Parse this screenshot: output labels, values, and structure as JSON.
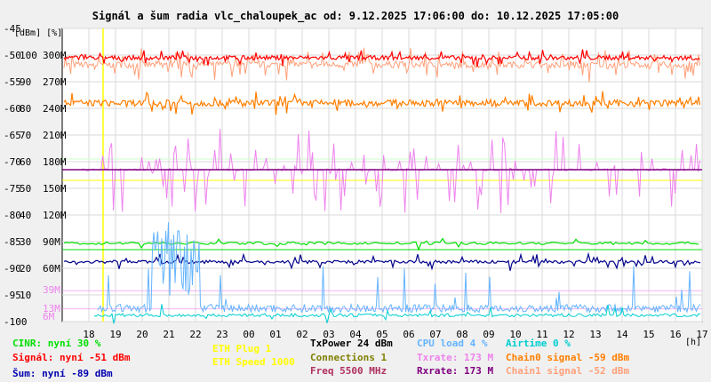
{
  "chart_data": {
    "type": "line",
    "title": "Signál a šum radia vlc_chaloupek_ac od: 9.12.2025 17:06:00 do: 10.12.2025 17:05:00",
    "ylabel": "[dBm] [%]",
    "xlabel": "[h]",
    "x_ticks": [
      "18",
      "19",
      "20",
      "21",
      "22",
      "23",
      "00",
      "01",
      "02",
      "03",
      "04",
      "05",
      "06",
      "07",
      "08",
      "09",
      "10",
      "11",
      "12",
      "13",
      "14",
      "15",
      "16",
      "17"
    ],
    "y_ticks_dbm": [
      "-45",
      "-50",
      "-55",
      "-60",
      "-65",
      "-70",
      "-75",
      "-80",
      "-85",
      "-90",
      "-95",
      "-100"
    ],
    "y_ticks_pct": [
      "100",
      "90",
      "80",
      "70",
      "60",
      "50",
      "40",
      "30",
      "20",
      "10"
    ],
    "y_ticks_rate": [
      "300M",
      "270M",
      "240M",
      "210M",
      "180M",
      "150M",
      "120M",
      "90M",
      "60M",
      "39M",
      "13M",
      "6M"
    ],
    "ylim_dbm": [
      -100,
      -45
    ],
    "grid": true,
    "series": [
      {
        "name": "Signál",
        "color": "#ff0000",
        "level_dbm": -51
      },
      {
        "name": "Chain0 signal",
        "color": "#ff7f00",
        "level_dbm": -59
      },
      {
        "name": "Chain1 signal",
        "color": "#ffa07a",
        "level_dbm": -52
      },
      {
        "name": "Txrate",
        "color": "#ee82ee",
        "level_rate": "173 M"
      },
      {
        "name": "Rxrate",
        "color": "#800080",
        "level_rate": "173 M"
      },
      {
        "name": "CINR",
        "color": "#00ff00",
        "level_pct": 30
      },
      {
        "name": "Šum",
        "color": "#00008b",
        "level_dbm": -89
      },
      {
        "name": "CPU load",
        "color": "#64b4ff",
        "level_pct": 4
      },
      {
        "name": "Airtime",
        "color": "#00ced1",
        "level_pct": 0
      }
    ]
  },
  "legend": {
    "cinr": "CINR: nyní 30 %",
    "signal": "Signál: nyní -51 dBm",
    "noise": "Šum: nyní -89 dBm",
    "eth_plug": "ETH Plug 1",
    "eth_speed": "ETH Speed 1000",
    "txpower": "TxPower 24 dBm",
    "connections": "Connections 1",
    "freq": "Freq 5500 MHz",
    "cpu": "CPU load 4 %",
    "txrate": "Txrate: 173 M",
    "rxrate": "Rxrate: 173 M",
    "airtime": "Airtime 0 %",
    "chain0": "Chain0 signal -59 dBm",
    "chain1": "Chain1 signal -52 dBm"
  },
  "colors": {
    "cinr": "#00e000",
    "signal": "#ff0000",
    "noise": "#0000b0",
    "eth": "#ffff00",
    "txpower": "#000000",
    "connections": "#808000",
    "freq": "#b03060",
    "cpu": "#64b4ff",
    "txrate": "#ee82ee",
    "rxrate": "#800080",
    "airtime": "#00ced1",
    "chain0": "#ff7f00",
    "chain1": "#ffa07a"
  }
}
